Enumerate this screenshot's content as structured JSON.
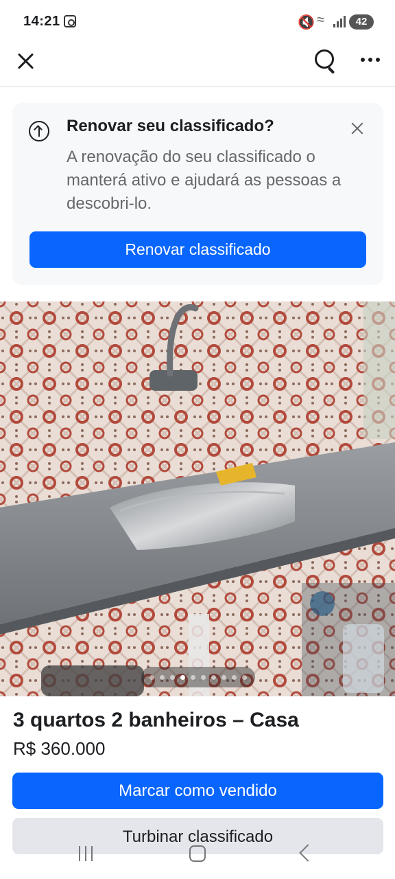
{
  "status": {
    "time": "14:21",
    "battery": "42",
    "icons": [
      "screen-record-icon",
      "mute-icon",
      "wifi-icon",
      "signal-icon",
      "battery-icon"
    ]
  },
  "topbar": {
    "icons": [
      "close-icon",
      "search-icon",
      "more-icon"
    ]
  },
  "renew": {
    "title": "Renovar seu classificado?",
    "body": "A renovação do seu classificado o manterá ativo e ajudará as pessoas a descobri-lo.",
    "button": "Renovar classificado",
    "icons": [
      "arrow-up-circle-icon",
      "dismiss-icon"
    ]
  },
  "carousel": {
    "total": 10,
    "current": 4
  },
  "listing": {
    "title": "3 quartos 2 banheiros – Casa",
    "price": "R$ 360.000",
    "mark_sold": "Marcar como vendido",
    "boost": "Turbinar classificado"
  },
  "colors": {
    "primary": "#0866ff",
    "secondary_btn": "#e4e6eb",
    "card_bg": "#f7f8fa",
    "text": "#1c1e21",
    "muted": "#65676b"
  }
}
